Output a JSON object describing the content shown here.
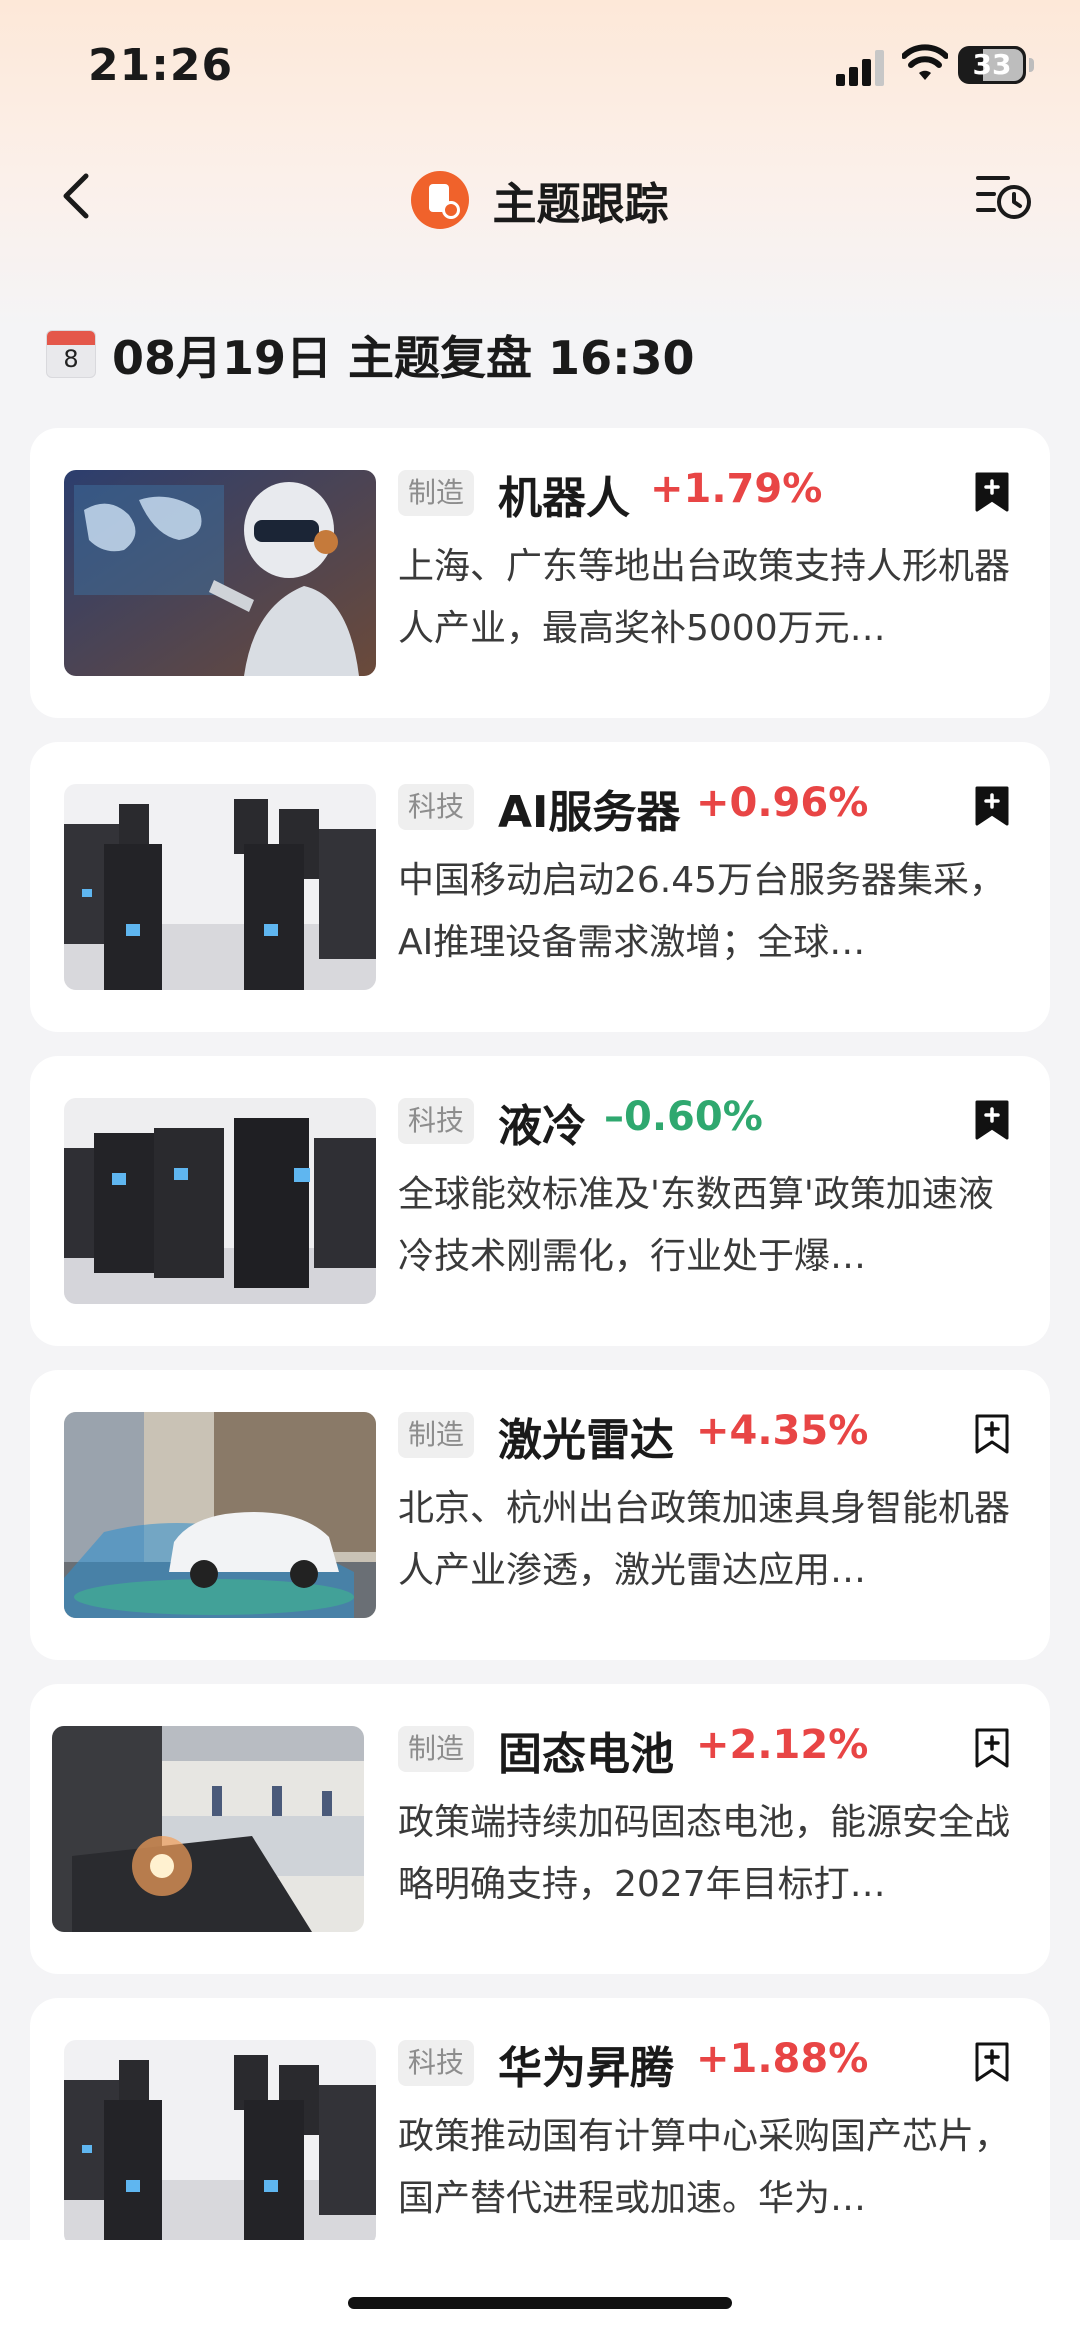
{
  "status": {
    "time": "21:26",
    "battery": "33"
  },
  "nav": {
    "title": "主题跟踪"
  },
  "date": {
    "day": "8",
    "text": "08月19日 主题复盘 16:30"
  },
  "colors": {
    "up": "#e84545",
    "down": "#2fa86f",
    "accent": "#f0622b"
  },
  "cards": [
    {
      "tag": "制造",
      "name": "机器人",
      "change": "+1.79%",
      "direction": "up",
      "bookmarked": true,
      "image": "robot-image",
      "desc": "上海、广东等地出台政策支持人形机器人产业，最高奖补5000万元…"
    },
    {
      "tag": "科技",
      "name": "AI服务器",
      "change": "+0.96%",
      "direction": "up",
      "bookmarked": true,
      "image": "server-image",
      "desc": "中国移动启动26.45万台服务器集采，AI推理设备需求激增；全球…"
    },
    {
      "tag": "科技",
      "name": "液冷",
      "change": "–0.60%",
      "direction": "down",
      "bookmarked": true,
      "image": "server-image",
      "desc": "全球能效标准及'东数西算'政策加速液冷技术刚需化，行业处于爆…"
    },
    {
      "tag": "制造",
      "name": "激光雷达",
      "change": "+4.35%",
      "direction": "up",
      "bookmarked": false,
      "image": "car-image",
      "desc": "北京、杭州出台政策加速具身智能机器人产业渗透，激光雷达应用…"
    },
    {
      "tag": "制造",
      "name": "固态电池",
      "change": "+2.12%",
      "direction": "up",
      "bookmarked": false,
      "image": "factory-image",
      "desc": "政策端持续加码固态电池，能源安全战略明确支持，2027年目标打…"
    },
    {
      "tag": "科技",
      "name": "华为昇腾",
      "change": "+1.88%",
      "direction": "up",
      "bookmarked": false,
      "image": "server-image",
      "desc": "政策推动国有计算中心采购国产芯片，国产替代进程或加速。华为…"
    }
  ]
}
